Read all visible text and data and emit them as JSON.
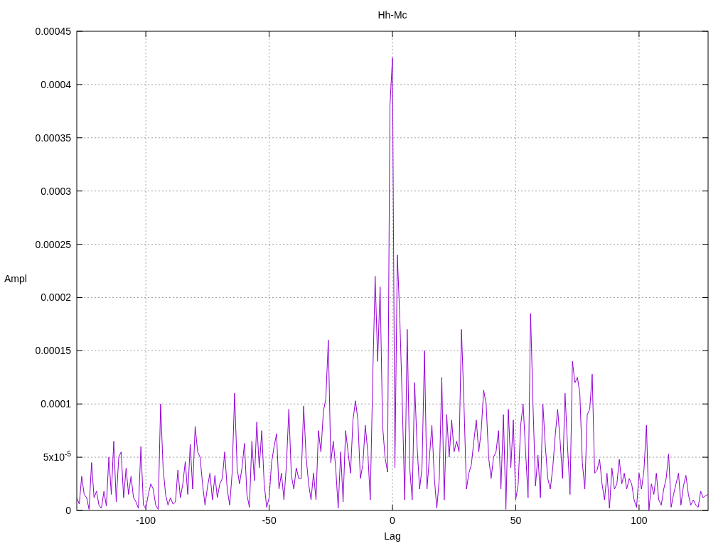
{
  "chart_data": {
    "type": "line",
    "grid": true,
    "title": "Hh-Mc",
    "xlabel": "Lag",
    "ylabel": "Ampl",
    "xlim": [
      -128,
      128
    ],
    "ylim": [
      0,
      0.00045
    ],
    "xticks": [
      -100,
      -50,
      0,
      50,
      100
    ],
    "yticks": [
      {
        "value": 0,
        "label": "0"
      },
      {
        "value": 5e-05,
        "label": "5x10$^{-5}$"
      },
      {
        "value": 0.0001,
        "label": "0.0001"
      },
      {
        "value": 0.00015,
        "label": "0.00015"
      },
      {
        "value": 0.0002,
        "label": "0.0002"
      },
      {
        "value": 0.00025,
        "label": "0.00025"
      },
      {
        "value": 0.0003,
        "label": "0.0003"
      },
      {
        "value": 0.00035,
        "label": "0.00035"
      },
      {
        "value": 0.0004,
        "label": "0.0004"
      },
      {
        "value": 0.00045,
        "label": "0.00045"
      }
    ],
    "x": [
      -128,
      -127,
      -126,
      -125,
      -124,
      -123,
      -122,
      -121,
      -120,
      -119,
      -118,
      -117,
      -116,
      -115,
      -114,
      -113,
      -112,
      -111,
      -110,
      -109,
      -108,
      -107,
      -106,
      -105,
      -104,
      -103,
      -102,
      -101,
      -100,
      -99,
      -98,
      -97,
      -96,
      -95,
      -94,
      -93,
      -92,
      -91,
      -90,
      -89,
      -88,
      -87,
      -86,
      -85,
      -84,
      -83,
      -82,
      -81,
      -80,
      -79,
      -78,
      -77,
      -76,
      -75,
      -74,
      -73,
      -72,
      -71,
      -70,
      -69,
      -68,
      -67,
      -66,
      -65,
      -64,
      -63,
      -62,
      -61,
      -60,
      -59,
      -58,
      -57,
      -56,
      -55,
      -54,
      -53,
      -52,
      -51,
      -50,
      -49,
      -48,
      -47,
      -46,
      -45,
      -44,
      -43,
      -42,
      -41,
      -40,
      -39,
      -38,
      -37,
      -36,
      -35,
      -34,
      -33,
      -32,
      -31,
      -30,
      -29,
      -28,
      -27,
      -26,
      -25,
      -24,
      -23,
      -22,
      -21,
      -20,
      -19,
      -18,
      -17,
      -16,
      -15,
      -14,
      -13,
      -12,
      -11,
      -10,
      -9,
      -8,
      -7,
      -6,
      -5,
      -4,
      -3,
      -2,
      -1,
      0,
      1,
      2,
      3,
      4,
      5,
      6,
      7,
      8,
      9,
      10,
      11,
      12,
      13,
      14,
      15,
      16,
      17,
      18,
      19,
      20,
      21,
      22,
      23,
      24,
      25,
      26,
      27,
      28,
      29,
      30,
      31,
      32,
      33,
      34,
      35,
      36,
      37,
      38,
      39,
      40,
      41,
      42,
      43,
      44,
      45,
      46,
      47,
      48,
      49,
      50,
      51,
      52,
      53,
      54,
      55,
      56,
      57,
      58,
      59,
      60,
      61,
      62,
      63,
      64,
      65,
      66,
      67,
      68,
      69,
      70,
      71,
      72,
      73,
      74,
      75,
      76,
      77,
      78,
      79,
      80,
      81,
      82,
      83,
      84,
      85,
      86,
      87,
      88,
      89,
      90,
      91,
      92,
      93,
      94,
      95,
      96,
      97,
      98,
      99,
      100,
      101,
      102,
      103,
      104,
      105,
      106,
      107,
      108,
      109,
      110,
      111,
      112,
      113,
      114,
      115,
      116,
      117,
      118,
      119,
      120,
      121,
      122,
      123,
      124,
      125,
      126,
      127,
      128
    ],
    "series": [
      {
        "color": "#9400d3",
        "values": [
          1.2e-05,
          6e-06,
          3.2e-05,
          1.5e-05,
          1.2e-05,
          1e-06,
          4.5e-05,
          1.2e-05,
          1.8e-05,
          5e-06,
          2e-06,
          1.8e-05,
          4e-06,
          5e-05,
          1.5e-05,
          6.5e-05,
          8e-06,
          5e-05,
          5.5e-05,
          1.2e-05,
          4e-05,
          1.5e-05,
          3.2e-05,
          1.2e-05,
          8e-06,
          2e-06,
          6e-05,
          5e-06,
          2e-06,
          1.5e-05,
          2.5e-05,
          2e-05,
          5e-06,
          1e-06,
          0.0001,
          4e-05,
          1.5e-05,
          5e-06,
          1.2e-05,
          6e-06,
          8e-06,
          3.8e-05,
          1.2e-05,
          2.5e-05,
          4.6e-05,
          1.5e-05,
          6.2e-05,
          2e-05,
          7.9e-05,
          5.5e-05,
          5e-05,
          2.5e-05,
          5e-06,
          2.2e-05,
          3.5e-05,
          1e-05,
          3.3e-05,
          1.2e-05,
          2.5e-05,
          3e-05,
          5.5e-05,
          2e-05,
          5e-06,
          3.5e-05,
          0.00011,
          4e-05,
          2.5e-05,
          4e-05,
          6.3e-05,
          1.5e-05,
          3e-06,
          6.5e-05,
          2.8e-05,
          8.3e-05,
          4e-05,
          7.5e-05,
          2.5e-05,
          3e-06,
          1.2e-05,
          4.5e-05,
          6e-05,
          7.2e-05,
          2e-05,
          3.5e-05,
          1e-05,
          4.2e-05,
          9.5e-05,
          3.3e-05,
          2e-05,
          4e-05,
          3e-05,
          3e-05,
          9.8e-05,
          5e-05,
          2.5e-05,
          1e-05,
          3.5e-05,
          1e-05,
          7.5e-05,
          5.5e-05,
          9.3e-05,
          0.000105,
          0.00016,
          4.5e-05,
          6.5e-05,
          4e-05,
          2e-06,
          5.5e-05,
          8e-06,
          7.5e-05,
          5.5e-05,
          3.5e-05,
          8.5e-05,
          0.000103,
          8.5e-05,
          3e-05,
          4.3e-05,
          8e-05,
          5.5e-05,
          1e-05,
          0.000125,
          0.00022,
          0.00014,
          0.00021,
          8e-05,
          5e-05,
          3.6e-05,
          0.00038,
          0.000425,
          4e-05,
          0.00024,
          0.00018,
          0.0001,
          1e-05,
          0.00017,
          4e-05,
          1e-05,
          0.00012,
          6e-05,
          2e-05,
          4e-05,
          0.00015,
          2e-05,
          5e-05,
          8e-05,
          3e-05,
          2e-06,
          3e-05,
          0.000125,
          1e-05,
          9e-05,
          5e-05,
          8.5e-05,
          5.5e-05,
          6.5e-05,
          5.5e-05,
          0.00017,
          0.0001,
          2e-05,
          3.5e-05,
          4.3e-05,
          6.5e-05,
          8.5e-05,
          5.5e-05,
          7.5e-05,
          0.000113,
          0.0001,
          5e-05,
          3e-05,
          5e-05,
          5.5e-05,
          7.5e-05,
          2e-05,
          9e-05,
          1e-06,
          9.5e-05,
          4e-05,
          8.5e-05,
          1e-05,
          2.5e-05,
          8e-05,
          0.0001,
          5.5e-05,
          1.2e-05,
          0.000185,
          0.0001,
          2.3e-05,
          5.2e-05,
          1.2e-05,
          0.0001,
          6e-05,
          3e-05,
          2e-05,
          4e-05,
          7e-05,
          9.5e-05,
          6.5e-05,
          3e-05,
          0.00011,
          6e-05,
          1.5e-05,
          0.00014,
          0.00012,
          0.000125,
          0.00011,
          4.5e-05,
          2e-05,
          9e-05,
          9.5e-05,
          0.000128,
          3.5e-05,
          3.8e-05,
          4.8e-05,
          2.5e-05,
          1e-05,
          3.5e-05,
          2e-06,
          4e-05,
          2e-05,
          2.5e-05,
          4.8e-05,
          2.5e-05,
          3.5e-05,
          2e-05,
          3e-05,
          2.5e-05,
          1e-05,
          3e-06,
          3.5e-05,
          2e-05,
          3.8e-05,
          8e-05,
          0,
          2.5e-05,
          1.5e-05,
          3.5e-05,
          1e-05,
          5e-06,
          2e-05,
          3e-05,
          5.3e-05,
          3e-06,
          1.5e-05,
          2.5e-05,
          3.5e-05,
          5e-06,
          2.3e-05,
          3.3e-05,
          1.5e-05,
          5e-06,
          1e-05,
          5e-06,
          3e-06,
          1.8e-05,
          1.2e-05,
          1.4e-05,
          1.5e-05
        ]
      }
    ]
  }
}
